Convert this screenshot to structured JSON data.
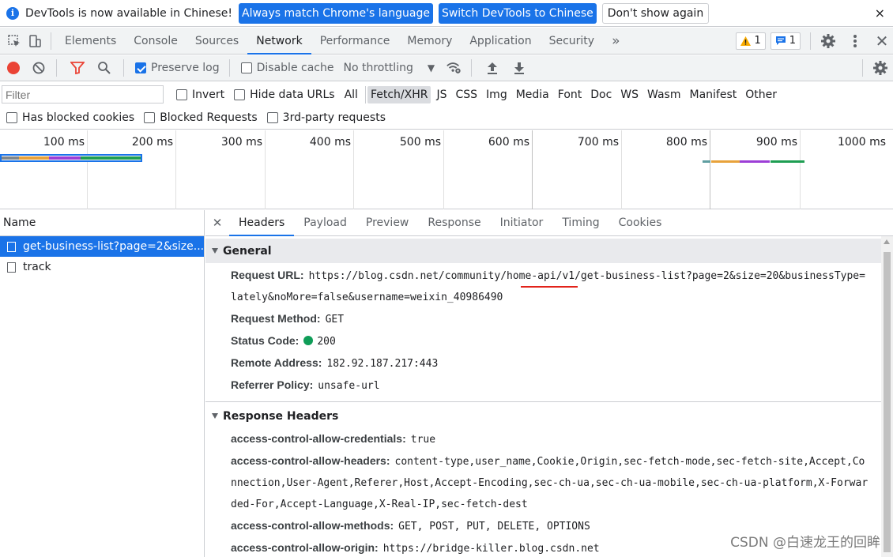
{
  "infobar": {
    "message": "DevTools is now available in Chinese!",
    "btn_match": "Always match Chrome's language",
    "btn_switch": "Switch DevTools to Chinese",
    "btn_dismiss": "Don't show again",
    "close": "×"
  },
  "tabs": [
    "Elements",
    "Console",
    "Sources",
    "Network",
    "Performance",
    "Memory",
    "Application",
    "Security"
  ],
  "more_tabs": "»",
  "badges": {
    "warnings": "1",
    "messages": "1"
  },
  "toolbar": {
    "preserve_log": "Preserve log",
    "disable_cache": "Disable cache",
    "throttling": "No throttling"
  },
  "filter": {
    "placeholder": "Filter",
    "invert": "Invert",
    "hide_data_urls": "Hide data URLs",
    "types": [
      "All",
      "Fetch/XHR",
      "JS",
      "CSS",
      "Img",
      "Media",
      "Font",
      "Doc",
      "WS",
      "Wasm",
      "Manifest",
      "Other"
    ],
    "active_type": "Fetch/XHR",
    "has_blocked_cookies": "Has blocked cookies",
    "blocked_requests": "Blocked Requests",
    "third_party": "3rd-party requests"
  },
  "timeline": {
    "ticks": [
      "100 ms",
      "200 ms",
      "300 ms",
      "400 ms",
      "500 ms",
      "600 ms",
      "700 ms",
      "800 ms",
      "900 ms",
      "1000 ms"
    ]
  },
  "requests": {
    "header": "Name",
    "items": [
      "get-business-list?page=2&size...",
      "track"
    ]
  },
  "detail_tabs": [
    "Headers",
    "Payload",
    "Preview",
    "Response",
    "Initiator",
    "Timing",
    "Cookies"
  ],
  "general": {
    "title": "General",
    "request_url_label": "Request URL:",
    "request_url": "https://blog.csdn.net/community/home-api/v1/get-business-list?page=2&size=20&businessType=lately&noMore=false&username=weixin_40986490",
    "request_method_label": "Request Method:",
    "request_method": "GET",
    "status_code_label": "Status Code:",
    "status_code": "200",
    "remote_address_label": "Remote Address:",
    "remote_address": "182.92.187.217:443",
    "referrer_policy_label": "Referrer Policy:",
    "referrer_policy": "unsafe-url"
  },
  "response_headers": {
    "title": "Response Headers",
    "items": [
      {
        "k": "access-control-allow-credentials:",
        "v": "true"
      },
      {
        "k": "access-control-allow-headers:",
        "v": "content-type,user_name,Cookie,Origin,sec-fetch-mode,sec-fetch-site,Accept,Connection,User-Agent,Referer,Host,Accept-Encoding,sec-ch-ua,sec-ch-ua-mobile,sec-ch-ua-platform,X-Forwarded-For,Accept-Language,X-Real-IP,sec-fetch-dest"
      },
      {
        "k": "access-control-allow-methods:",
        "v": "GET, POST, PUT, DELETE, OPTIONS"
      },
      {
        "k": "access-control-allow-origin:",
        "v": "https://bridge-killer.blog.csdn.net"
      }
    ]
  },
  "watermark": "CSDN @白速龙王的回眸",
  "colors": {
    "accent": "#1a73e8",
    "record": "#ea4335",
    "status_ok": "#0f9d58",
    "annotation": "#e2231a"
  }
}
